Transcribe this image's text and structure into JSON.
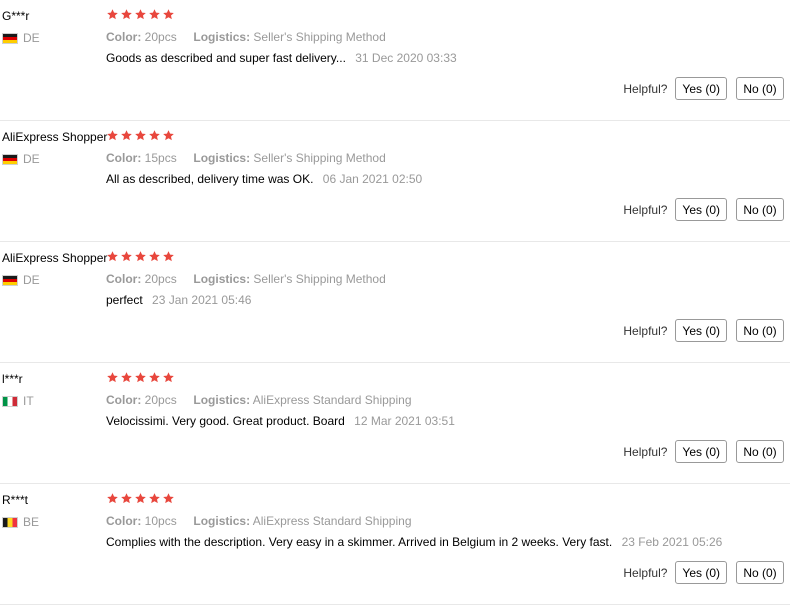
{
  "star_color": "#e8473d",
  "attr_labels": {
    "color": "Color:",
    "logistics": "Logistics:"
  },
  "helpful_label": "Helpful?",
  "reviews": [
    {
      "user": "G***r",
      "country": "DE",
      "flag": "de",
      "rating": 5,
      "color": "20pcs",
      "logistics": "Seller's Shipping Method",
      "text": "Goods as described and super fast delivery...",
      "date": "31 Dec 2020 03:33",
      "yes": "Yes (0)",
      "no": "No (0)"
    },
    {
      "user": "AliExpress Shopper",
      "country": "DE",
      "flag": "de",
      "rating": 5,
      "color": "15pcs",
      "logistics": "Seller's Shipping Method",
      "text": "All as described, delivery time was OK.",
      "date": "06 Jan 2021 02:50",
      "yes": "Yes (0)",
      "no": "No (0)"
    },
    {
      "user": "AliExpress Shopper",
      "country": "DE",
      "flag": "de",
      "rating": 5,
      "color": "20pcs",
      "logistics": "Seller's Shipping Method",
      "text": "perfect",
      "date": "23 Jan 2021 05:46",
      "yes": "Yes (0)",
      "no": "No (0)"
    },
    {
      "user": "l***r",
      "country": "IT",
      "flag": "it",
      "rating": 5,
      "color": "20pcs",
      "logistics": "AliExpress Standard Shipping",
      "text": "Velocissimi. Very good. Great product. Board",
      "date": "12 Mar 2021 03:51",
      "yes": "Yes (0)",
      "no": "No (0)"
    },
    {
      "user": "R***t",
      "country": "BE",
      "flag": "be",
      "rating": 5,
      "color": "10pcs",
      "logistics": "AliExpress Standard Shipping",
      "text": "Complies with the description. Very easy in a skimmer. Arrived in Belgium in 2 weeks. Very fast.",
      "date": "23 Feb 2021 05:26",
      "yes": "Yes (0)",
      "no": "No (0)"
    }
  ]
}
